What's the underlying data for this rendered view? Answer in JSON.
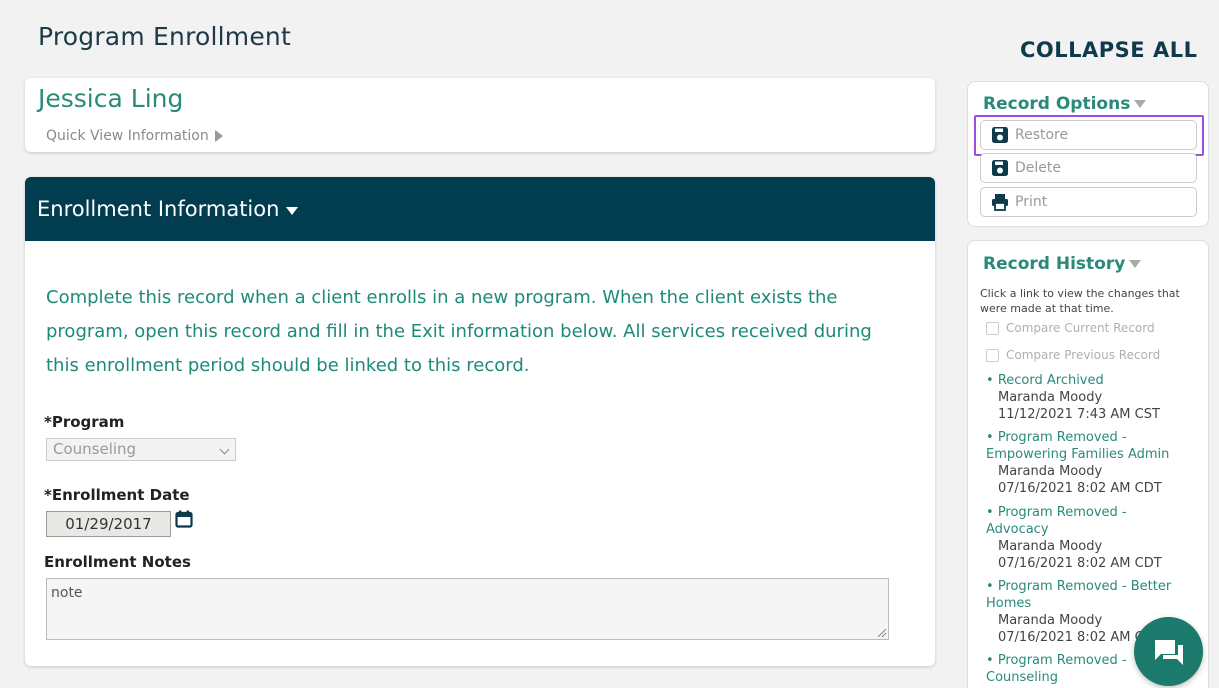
{
  "page": {
    "title": "Program Enrollment",
    "collapse_all": "COLLAPSE ALL"
  },
  "client": {
    "name": "Jessica Ling",
    "quick_view": "Quick View Information"
  },
  "enrollment": {
    "header": "Enrollment Information",
    "intro_lines": [
      "Complete this record when a client enrolls in a new program. When the client exists the",
      "program, open this record and fill in the Exit information below. All services received during",
      "this enrollment period should be linked to this record."
    ],
    "program_label": "*Program",
    "program_value": "Counseling",
    "date_label": "*Enrollment Date",
    "date_value": "01/29/2017",
    "notes_label": "Enrollment Notes",
    "notes_value": "note"
  },
  "record_options": {
    "title": "Record Options",
    "buttons": [
      {
        "label": "Restore",
        "icon": "save-icon"
      },
      {
        "label": "Delete",
        "icon": "save-icon"
      },
      {
        "label": "Print",
        "icon": "printer-icon"
      }
    ]
  },
  "record_history": {
    "title": "Record History",
    "help": "Click a link to view the changes that were made at that time.",
    "compare_current": "Compare Current Record",
    "compare_previous": "Compare Previous Record",
    "entries": [
      {
        "link_1": "Record Archived",
        "link_2": "",
        "user": "Maranda Moody",
        "time": "11/12/2021 7:43 AM CST"
      },
      {
        "link_1": "Program Removed -",
        "link_2": "Empowering Families Admin",
        "user": "Maranda Moody",
        "time": "07/16/2021 8:02 AM CDT"
      },
      {
        "link_1": "Program Removed -",
        "link_2": "Advocacy",
        "user": "Maranda Moody",
        "time": "07/16/2021 8:02 AM CDT"
      },
      {
        "link_1": "Program Removed - Better",
        "link_2": "Homes",
        "user": "Maranda Moody",
        "time": "07/16/2021 8:02 AM C"
      },
      {
        "link_1": "Program Removed -",
        "link_2": "Counseling",
        "user": "",
        "time": ""
      }
    ]
  },
  "colors": {
    "header_bg": "#023c4f",
    "accent": "#2a8a7a",
    "highlight": "#9b4fe0",
    "chat_bg": "#1b7a6b"
  }
}
